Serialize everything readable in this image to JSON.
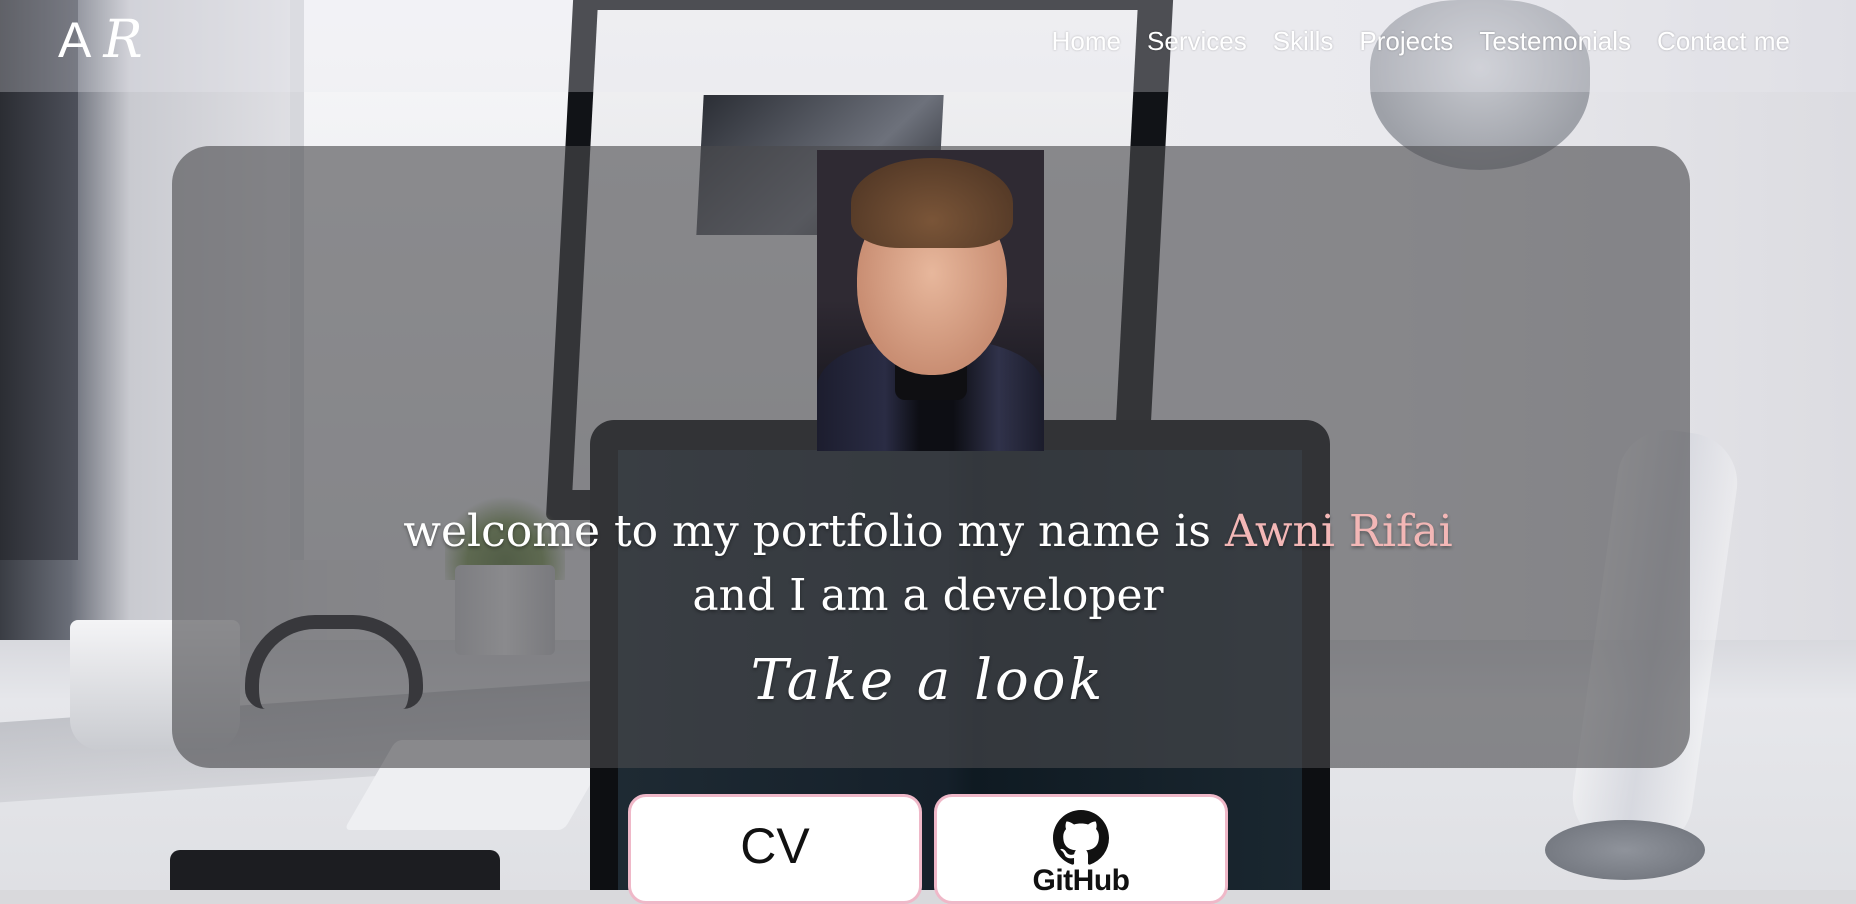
{
  "nav": {
    "logo_a": "A",
    "logo_r": "R",
    "items": [
      "Home",
      "Services",
      "Skills",
      "Projects",
      "Testemonials",
      "Contact me"
    ]
  },
  "hero": {
    "line1_prefix": "welcome to my portfolio my name is",
    "name": "Awni Rifai",
    "line2": "and I am a developer",
    "tagline": "Take a look",
    "name_color": "#f3b7b6"
  },
  "buttons": {
    "cv_label": "CV",
    "github_label": "GitHub",
    "border_color": "#efb8c8"
  },
  "icons": {
    "github": "github-octocat-icon"
  }
}
